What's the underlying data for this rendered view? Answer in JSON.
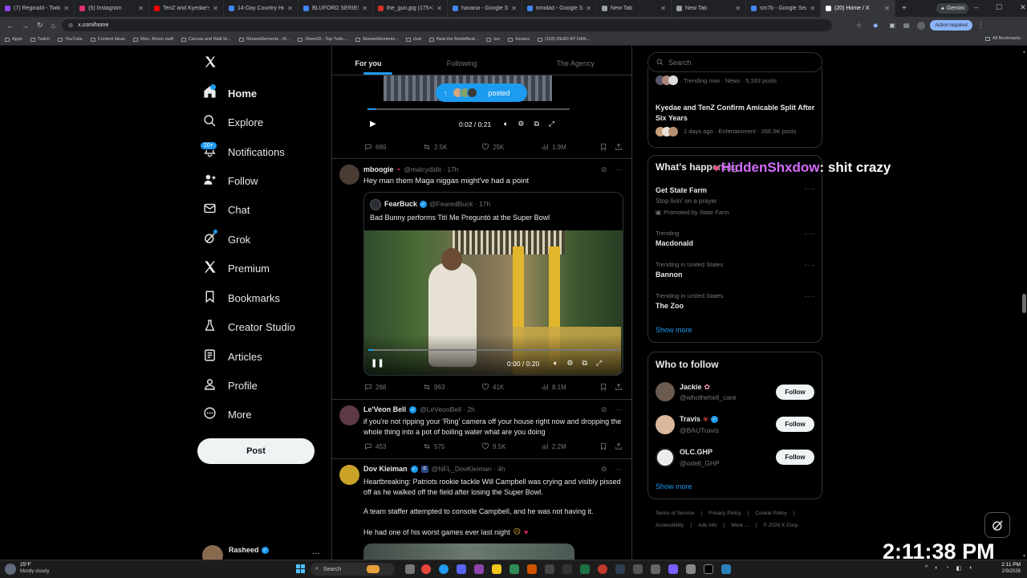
{
  "browser": {
    "tabs": [
      {
        "label": "(7) Reginald - Twitch",
        "color": "#9146ff"
      },
      {
        "label": "(5) Instagram",
        "color": "#e1306c"
      },
      {
        "label": "TenZ and Kyedae's Br...",
        "color": "#ff0000"
      },
      {
        "label": "14-Day Country Hop...",
        "color": "#4285f4"
      },
      {
        "label": "BLUFORD SERIES BO...",
        "color": "#4285f4"
      },
      {
        "label": "the_gun.jpg (175×3...",
        "color": "#d93025"
      },
      {
        "label": "havana - Google Sea...",
        "color": "#4285f4"
      },
      {
        "label": "trinidad - Google Se...",
        "color": "#4285f4"
      },
      {
        "label": "New Tab",
        "color": "#9aa0a6"
      },
      {
        "label": "New Tab",
        "color": "#9aa0a6"
      },
      {
        "label": "sm7b - Google Searc...",
        "color": "#4285f4"
      },
      {
        "label": "(20) Home / X",
        "color": "#ffffff"
      }
    ],
    "gemini_label": "Gemini",
    "url": "x.com/home",
    "action_required": "Action required",
    "bookmarks": [
      "Apps",
      "Twitch",
      "YouTube",
      "Content Ideas",
      "Misc. Room stuff",
      "Canvas and Wall St...",
      "StreamElements - M...",
      "SheerID - Top Twitc...",
      "StreamElements -",
      "chat",
      "Beat the BombBeat...",
      "oor",
      "houses",
      "(103) DEAD BY DAN..."
    ],
    "all_bookmarks": "All Bookmarks"
  },
  "nav": {
    "items": [
      {
        "label": "Home",
        "icon": "home-icon"
      },
      {
        "label": "Explore",
        "icon": "search-icon"
      },
      {
        "label": "Notifications",
        "icon": "bell-icon"
      },
      {
        "label": "Follow",
        "icon": "follow-icon"
      },
      {
        "label": "Chat",
        "icon": "mail-icon"
      },
      {
        "label": "Grok",
        "icon": "grok-icon"
      },
      {
        "label": "Premium",
        "icon": "x-logo-icon"
      },
      {
        "label": "Bookmarks",
        "icon": "bookmark-icon"
      },
      {
        "label": "Creator Studio",
        "icon": "flask-icon"
      },
      {
        "label": "Articles",
        "icon": "article-icon"
      },
      {
        "label": "Profile",
        "icon": "person-icon"
      },
      {
        "label": "More",
        "icon": "more-circle-icon"
      }
    ],
    "notif_badge": "20+",
    "post_button": "Post",
    "account_name": "Rasheed"
  },
  "feed": {
    "tabs": [
      "For you",
      "Following",
      "The Agency"
    ],
    "posted_pill": "posted",
    "video1_time": "0:02 / 0:21",
    "post1_actions": {
      "replies": "689",
      "reposts": "2.5K",
      "likes": "25K",
      "views": "1.9M"
    },
    "post2": {
      "name": "mboogie",
      "handle": "@malcydidit · 17h",
      "text": "Hey man them Maga niggas might've had a point",
      "quote_name": "FearBuck",
      "quote_handle": "@FearedBuck · 17h",
      "quote_text": "Bad Bunny performs Tití Me Preguntó at the Super Bowl",
      "video_time": "0:00 / 0:20",
      "actions": {
        "replies": "268",
        "reposts": "963",
        "likes": "41K",
        "views": "8.1M"
      }
    },
    "post3": {
      "name": "Le'Veon Bell",
      "handle": "@LeVeonBell · 2h",
      "text": "if you're not ripping your 'Ring' camera off your house right now and dropping the whole thing into a pot of boiling water what are you doing",
      "actions": {
        "replies": "453",
        "reposts": "575",
        "likes": "9.5K",
        "views": "2.2M"
      }
    },
    "post4": {
      "name": "Dov Kleiman",
      "handle": "@NFL_DovKleiman · 4h",
      "text1": "Heartbreaking: Patriots rookie tackle Will Campbell was crying and visibly pissed off as he walked off the field after losing the Super Bowl.",
      "text2": "A team staffer attempted to console Campbell, and he was not having it.",
      "text3": "He had one of his worst games ever last night"
    }
  },
  "right": {
    "search_placeholder": "Search",
    "trend_top_meta": "Trending now · News · 5,163 posts",
    "kyedae_title": "Kyedae and TenZ Confirm Amicable Split After Six Years",
    "kyedae_meta": "2 days ago · Entertainment · 266.5K posts",
    "whats_happening": "What's happening",
    "trends": [
      {
        "small": "",
        "big": "Get State Farm",
        "sub": "Stop livin' on a prayer",
        "promo": "Promoted by State Farm"
      },
      {
        "small": "Trending",
        "big": "Macdonald"
      },
      {
        "small": "Trending in United States",
        "big": "Bannon"
      },
      {
        "small": "Trending in United States",
        "big": "The Zoo"
      }
    ],
    "show_more": "Show more",
    "who_to_follow": "Who to follow",
    "follow": [
      {
        "name": "Jackie",
        "handle": "@whothehell_care"
      },
      {
        "name": "Travis",
        "handle": "@BAUTravis"
      },
      {
        "name": "OLC.GHP",
        "handle": "@odell_GHP"
      }
    ],
    "follow_button": "Follow",
    "show_more2": "Show more",
    "footer1": [
      "Terms of Service",
      "Privacy Policy",
      "Cookie Policy"
    ],
    "footer2": [
      "Accessibility",
      "Ads info",
      "More ...",
      "© 2026 X Corp."
    ]
  },
  "overlay": {
    "chat_user": "HiddenShxdow",
    "chat_msg": ": shit crazy",
    "clock": "2:11:38 PM"
  },
  "taskbar": {
    "weather_temp": "25°F",
    "weather_desc": "Mostly cloudy",
    "search": "Search",
    "time": "2:11 PM",
    "date": "2/9/2026"
  }
}
